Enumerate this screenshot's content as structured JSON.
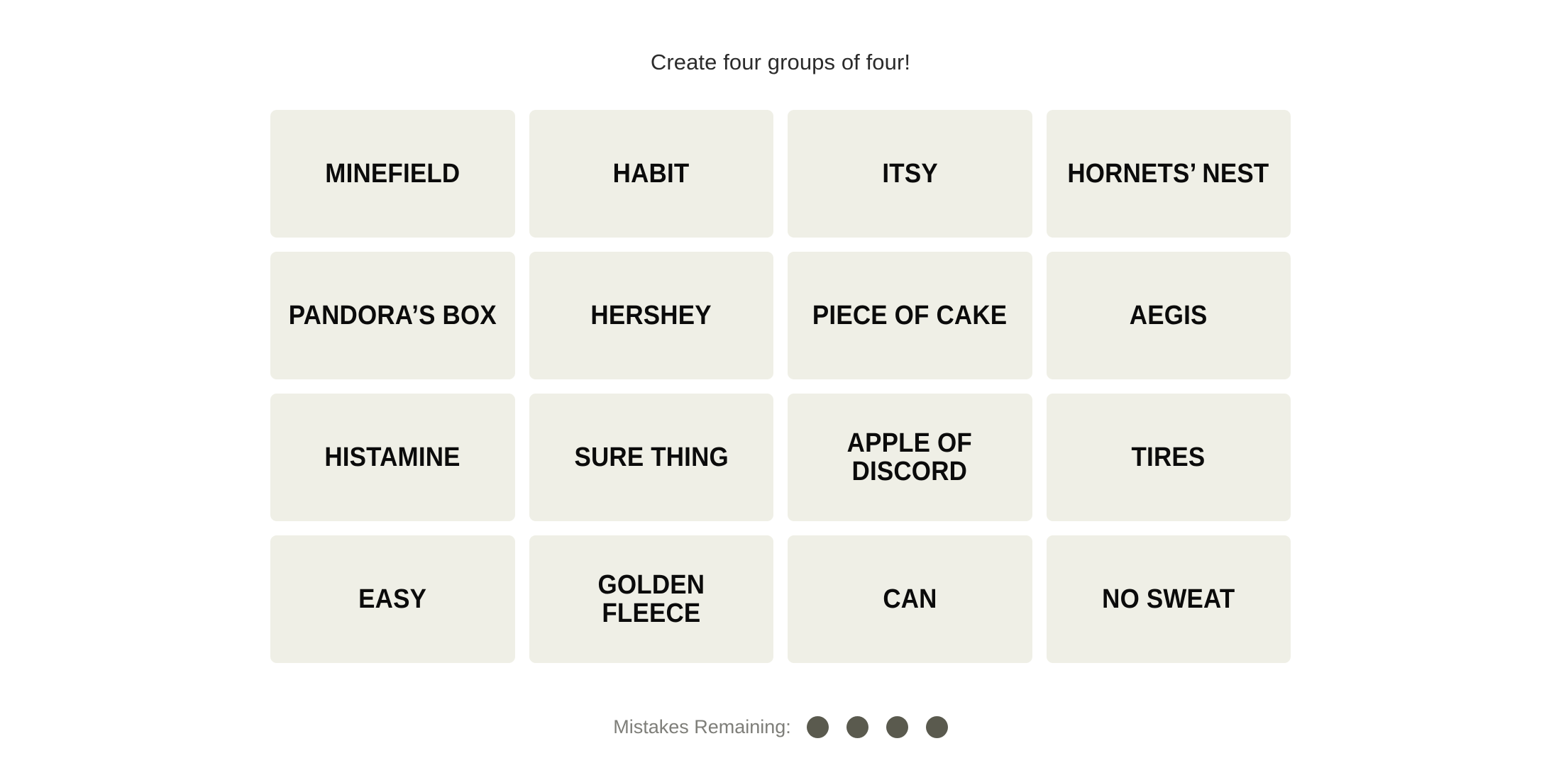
{
  "page": {
    "background_color": "#FFFFFF"
  },
  "header": {
    "instruction": "Create four groups of four!"
  },
  "board": {
    "rows": 4,
    "columns": 4,
    "tile_color": "#EFEFE6",
    "tile_text_color": "#0B0B0B",
    "tiles": [
      {
        "label": "MINEFIELD"
      },
      {
        "label": "HABIT"
      },
      {
        "label": "ITSY"
      },
      {
        "label": "HORNETS’ NEST"
      },
      {
        "label": "PANDORA’S BOX"
      },
      {
        "label": "HERSHEY"
      },
      {
        "label": "PIECE OF CAKE"
      },
      {
        "label": "AEGIS"
      },
      {
        "label": "HISTAMINE"
      },
      {
        "label": "SURE THING"
      },
      {
        "label": "APPLE OF\nDISCORD"
      },
      {
        "label": "TIRES"
      },
      {
        "label": "EASY"
      },
      {
        "label": "GOLDEN\nFLEECE"
      },
      {
        "label": "CAN"
      },
      {
        "label": "NO SWEAT"
      }
    ]
  },
  "footer": {
    "mistakes_label": "Mistakes Remaining:",
    "mistakes_remaining": 4,
    "dot_color": "#5A5A4E",
    "label_color": "#7E7E79",
    "dots": [
      {
        "state": "filled"
      },
      {
        "state": "filled"
      },
      {
        "state": "filled"
      },
      {
        "state": "filled"
      }
    ]
  }
}
